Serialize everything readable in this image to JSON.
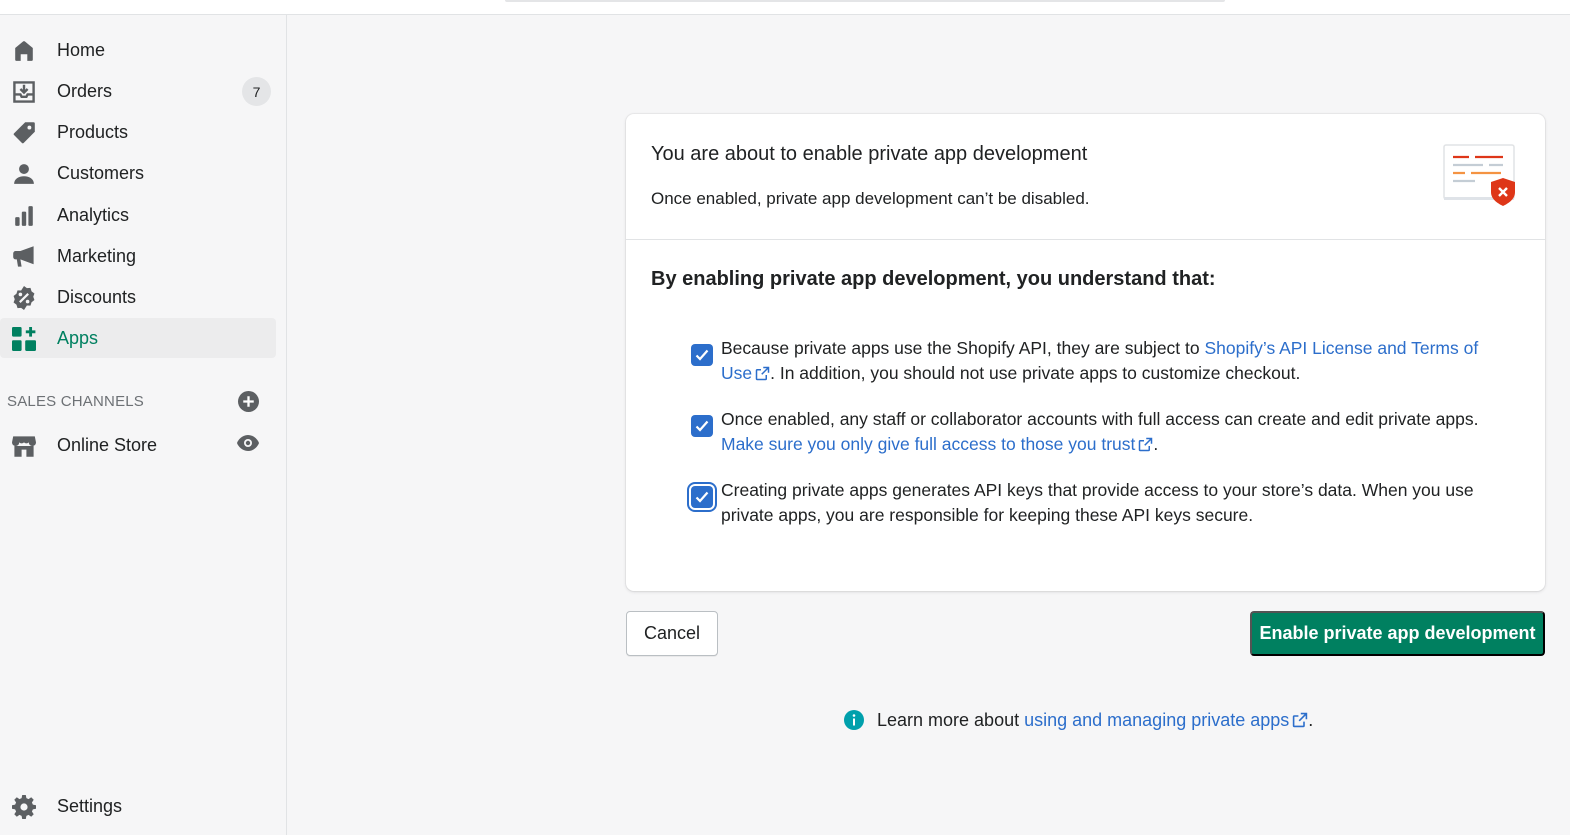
{
  "colors": {
    "accent_green": "#008060",
    "link_blue": "#2c6ecb",
    "checkbox_blue": "#2c6ecb",
    "info_teal": "#00a0ac",
    "illustration_shield": "#de3618"
  },
  "sidebar": {
    "items": [
      {
        "label": "Home",
        "icon": "home-icon"
      },
      {
        "label": "Orders",
        "icon": "orders-icon",
        "badge": "7"
      },
      {
        "label": "Products",
        "icon": "tag-icon"
      },
      {
        "label": "Customers",
        "icon": "person-icon"
      },
      {
        "label": "Analytics",
        "icon": "bar-chart-icon"
      },
      {
        "label": "Marketing",
        "icon": "megaphone-icon"
      },
      {
        "label": "Discounts",
        "icon": "discount-icon"
      },
      {
        "label": "Apps",
        "icon": "apps-icon",
        "active": true
      }
    ],
    "sales_channels": {
      "heading": "SALES CHANNELS",
      "items": [
        {
          "label": "Online Store",
          "icon": "store-icon"
        }
      ]
    },
    "settings": {
      "label": "Settings",
      "icon": "gear-icon"
    }
  },
  "modal": {
    "title": "You are about to enable private app development",
    "subtitle": "Once enabled, private app development can’t be disabled.",
    "section_title": "By enabling private app development, you understand that:",
    "checks": [
      {
        "checked": true,
        "text_before": "Because private apps use the Shopify API, they are subject to ",
        "link": "Shopify’s API License and Terms of Use",
        "text_after": ". In addition, you should not use private apps to customize checkout."
      },
      {
        "checked": true,
        "text_before": "Once enabled, any staff or collaborator accounts with full access can create and edit private apps. ",
        "link": "Make sure you only give full access to those you trust",
        "text_after": "."
      },
      {
        "checked": true,
        "text_before": "Creating private apps generates API keys that provide access to your store’s data. When you use private apps, you are responsible for keeping these API keys secure.",
        "link": "",
        "text_after": ""
      }
    ]
  },
  "actions": {
    "cancel_label": "Cancel",
    "primary_label": "Enable private app development"
  },
  "footer": {
    "text": "Learn more about ",
    "link": "using and managing private apps",
    "period": "."
  }
}
